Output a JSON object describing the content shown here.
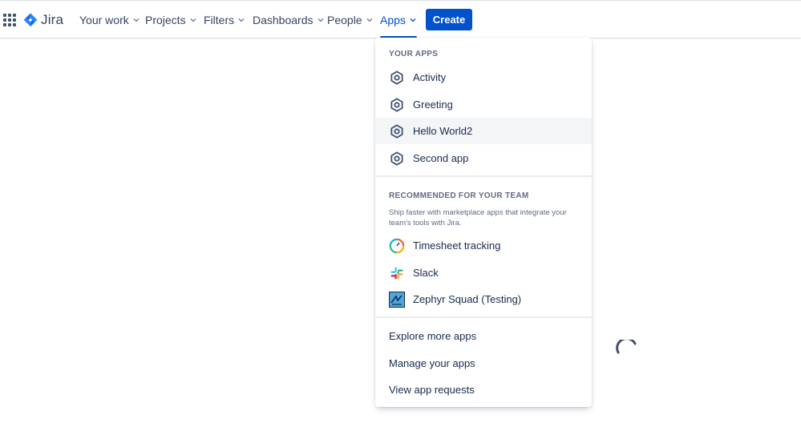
{
  "header": {
    "logo_text": "Jira",
    "nav": [
      {
        "label": "Your work"
      },
      {
        "label": "Projects"
      },
      {
        "label": "Filters"
      },
      {
        "label": "Dashboards"
      },
      {
        "label": "People"
      },
      {
        "label": "Apps"
      }
    ],
    "active_nav": "Apps",
    "create_label": "Create"
  },
  "apps_menu": {
    "your_apps_title": "YOUR APPS",
    "your_apps": [
      {
        "label": "Activity",
        "icon": "forge-app-icon"
      },
      {
        "label": "Greeting",
        "icon": "forge-app-icon"
      },
      {
        "label": "Hello World2",
        "icon": "forge-app-icon"
      },
      {
        "label": "Second app",
        "icon": "forge-app-icon"
      }
    ],
    "hovered_item": "Hello World2",
    "recommended_title": "RECOMMENDED FOR YOUR TEAM",
    "recommended_description": "Ship faster with marketplace apps that integrate your team's tools with Jira.",
    "recommended": [
      {
        "label": "Timesheet tracking",
        "icon": "timesheet-icon"
      },
      {
        "label": "Slack",
        "icon": "slack-icon"
      },
      {
        "label": "Zephyr Squad (Testing)",
        "icon": "zephyr-icon"
      }
    ],
    "links": [
      {
        "label": "Explore more apps"
      },
      {
        "label": "Manage your apps"
      },
      {
        "label": "View app requests"
      }
    ]
  },
  "colors": {
    "brand": "#0052cc",
    "text": "#172b4d",
    "subtle_text": "#5e6c84",
    "hover_bg": "#f4f5f7"
  }
}
